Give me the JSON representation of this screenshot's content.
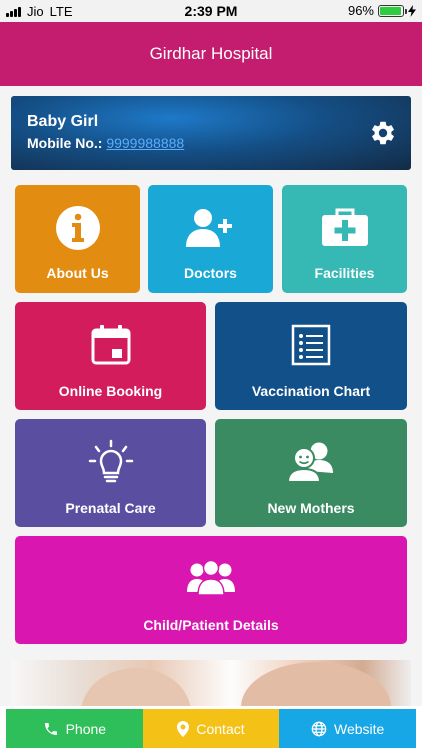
{
  "status_bar": {
    "carrier": "Jio",
    "network": "LTE",
    "time": "2:39 PM",
    "battery": "96%",
    "battery_level": 0.96
  },
  "header": {
    "title": "Girdhar Hospital"
  },
  "profile": {
    "name": "Baby Girl",
    "mobile_label": "Mobile No.:",
    "mobile_number": "9999988888",
    "settings_icon": "gear-icon"
  },
  "tiles": [
    {
      "label": "About Us",
      "icon": "info-icon",
      "color": "#e38c12"
    },
    {
      "label": "Doctors",
      "icon": "add-user-icon",
      "color": "#1aa8d6"
    },
    {
      "label": "Facilities",
      "icon": "medical-bag-icon",
      "color": "#36b9b4"
    },
    {
      "label": "Online Booking",
      "icon": "calendar-icon",
      "color": "#d21c5b"
    },
    {
      "label": "Vaccination Chart",
      "icon": "checklist-icon",
      "color": "#12508a"
    },
    {
      "label": "Prenatal Care",
      "icon": "lightbulb-icon",
      "color": "#5a4ea0"
    },
    {
      "label": "New Mothers",
      "icon": "people-icon",
      "color": "#3a8b62"
    },
    {
      "label": "Child/Patient Details",
      "icon": "group-icon",
      "color": "#d916af"
    }
  ],
  "bottom_bar": [
    {
      "label": "Phone",
      "icon": "phone-icon",
      "color": "#2ebf5a"
    },
    {
      "label": "Contact",
      "icon": "location-pin-icon",
      "color": "#f4c117"
    },
    {
      "label": "Website",
      "icon": "globe-icon",
      "color": "#17a6e6"
    }
  ]
}
